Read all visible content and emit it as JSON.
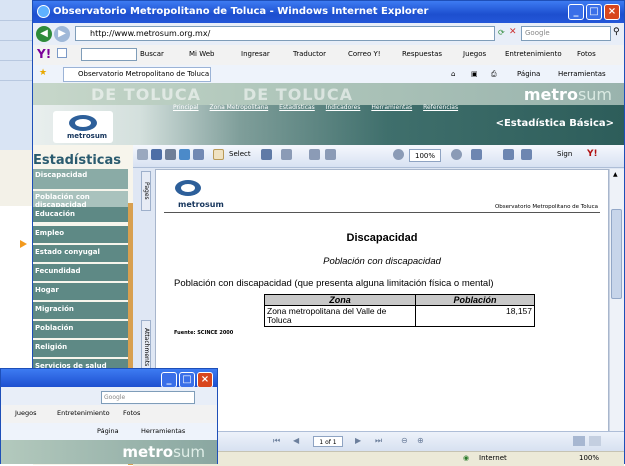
{
  "window": {
    "title": "Observatorio Metropolitano de Toluca - Windows Internet Explorer"
  },
  "address": {
    "url": "http://www.metrosum.org.mx/",
    "search_placeholder": "Google"
  },
  "yahoo_toolbar": {
    "buscar": "Buscar",
    "mi_web": "Mi Web",
    "ingresar": "Ingresar",
    "traducir": "Traductor",
    "correo": "Correo Y!",
    "respuestas": "Respuestas",
    "juegos": "Juegos",
    "entretenimiento": "Entretenimiento",
    "fotos": "Fotos"
  },
  "favbar": {
    "tab_title": "Observatorio Metropolitano de Toluca",
    "pagina": "Página",
    "herramientas": "Herramientas"
  },
  "site": {
    "banner_ghost_1": "DE TOLUCA",
    "banner_ghost_2": "DE TOLUCA",
    "logo_bold": "metro",
    "logo_light": "sum",
    "logo_small": "metrosum",
    "estadistica": "<Estadística Básica>",
    "menu": [
      "Principal",
      "Zona Metropolitana",
      "Estadísticas",
      "Indicadores",
      "Herramientas",
      "Referencias"
    ]
  },
  "leftnav": {
    "title": "Estadísticas",
    "items": [
      "Discapacidad",
      "Población con discapacidad",
      "Educación",
      "Empleo",
      "Estado conyugal",
      "Fecundidad",
      "Hogar",
      "Migración",
      "Población",
      "Religión",
      "Servicios de salud"
    ]
  },
  "viewer": {
    "select_label": "Select",
    "zoom": "100%",
    "sign": "Sign",
    "pages_tab": "Pages",
    "attachments_tab": "Attachments",
    "page_indicator": "1 of 1"
  },
  "document": {
    "org": "Observatorio Metropolitano de Toluca",
    "heading": "Discapacidad",
    "subheading": "Población con discapacidad",
    "description": "Población con discapacidad (que presenta alguna limitación física o mental)",
    "table": {
      "headers": [
        "Zona",
        "Población"
      ],
      "rows": [
        [
          "Zona metropolitana del Valle de Toluca",
          "18,157"
        ]
      ]
    },
    "source": "Fuente: SCINCE 2000"
  },
  "status": {
    "zone": "Internet",
    "zoom": "100%"
  },
  "bg_window": {
    "search": "Google",
    "juegos": "Juegos",
    "entretenimiento": "Entretenimiento",
    "fotos": "Fotos",
    "pagina": "Página",
    "herramientas": "Herramientas"
  }
}
